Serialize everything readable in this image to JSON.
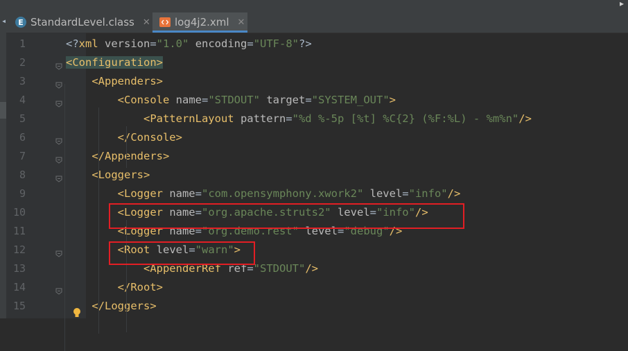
{
  "tabs": [
    {
      "label": "StandardLevel.class",
      "icon": "class-file-icon",
      "active": false
    },
    {
      "label": "log4j2.xml",
      "icon": "xml-file-icon",
      "active": true
    }
  ],
  "line_numbers": [
    "1",
    "2",
    "3",
    "4",
    "5",
    "6",
    "7",
    "8",
    "9",
    "10",
    "11",
    "12",
    "13",
    "14",
    "15"
  ],
  "code_lines": [
    [
      [
        "p",
        "<?"
      ],
      [
        "t",
        "xml "
      ],
      [
        "a",
        "version"
      ],
      [
        "p",
        "="
      ],
      [
        "v",
        "\"1.0\""
      ],
      [
        "p",
        " "
      ],
      [
        "a",
        "encoding"
      ],
      [
        "p",
        "="
      ],
      [
        "v",
        "\"UTF-8\""
      ],
      [
        "p",
        "?>"
      ]
    ],
    [
      [
        "hl",
        "<Configuration>"
      ]
    ],
    [
      [
        "p",
        "    "
      ],
      [
        "t",
        "<Appenders>"
      ]
    ],
    [
      [
        "p",
        "        "
      ],
      [
        "t",
        "<Console "
      ],
      [
        "a",
        "name"
      ],
      [
        "p",
        "="
      ],
      [
        "v",
        "\"STDOUT\""
      ],
      [
        "p",
        " "
      ],
      [
        "a",
        "target"
      ],
      [
        "p",
        "="
      ],
      [
        "v",
        "\"SYSTEM_OUT\""
      ],
      [
        "t",
        ">"
      ]
    ],
    [
      [
        "p",
        "            "
      ],
      [
        "t",
        "<PatternLayout "
      ],
      [
        "a",
        "pattern"
      ],
      [
        "p",
        "="
      ],
      [
        "v",
        "\"%d %-5p [%t] %C{2} (%F:%L) - %m%n\""
      ],
      [
        "t",
        "/>"
      ]
    ],
    [
      [
        "p",
        "        "
      ],
      [
        "t",
        "</Console>"
      ]
    ],
    [
      [
        "p",
        "    "
      ],
      [
        "t",
        "</Appenders>"
      ]
    ],
    [
      [
        "p",
        "    "
      ],
      [
        "t",
        "<Loggers>"
      ]
    ],
    [
      [
        "p",
        "        "
      ],
      [
        "t",
        "<Logger "
      ],
      [
        "a",
        "name"
      ],
      [
        "p",
        "="
      ],
      [
        "v",
        "\"com.opensymphony.xwork2\""
      ],
      [
        "p",
        " "
      ],
      [
        "a",
        "level"
      ],
      [
        "p",
        "="
      ],
      [
        "v",
        "\"info\""
      ],
      [
        "t",
        "/>"
      ]
    ],
    [
      [
        "p",
        "        "
      ],
      [
        "t",
        "<Logger "
      ],
      [
        "a",
        "name"
      ],
      [
        "p",
        "="
      ],
      [
        "v",
        "\"org.apache.struts2\""
      ],
      [
        "p",
        " "
      ],
      [
        "a",
        "level"
      ],
      [
        "p",
        "="
      ],
      [
        "v",
        "\"info\""
      ],
      [
        "t",
        "/>"
      ]
    ],
    [
      [
        "p",
        "        "
      ],
      [
        "t",
        "<Logger "
      ],
      [
        "a",
        "name"
      ],
      [
        "p",
        "="
      ],
      [
        "v",
        "\"org.demo.rest\""
      ],
      [
        "p",
        " "
      ],
      [
        "a",
        "level"
      ],
      [
        "p",
        "="
      ],
      [
        "v",
        "\"debug\""
      ],
      [
        "t",
        "/>"
      ]
    ],
    [
      [
        "p",
        "        "
      ],
      [
        "t",
        "<Root "
      ],
      [
        "a",
        "level"
      ],
      [
        "p",
        "="
      ],
      [
        "v",
        "\"warn\""
      ],
      [
        "t",
        ">"
      ]
    ],
    [
      [
        "p",
        "            "
      ],
      [
        "t",
        "<AppenderRef "
      ],
      [
        "a",
        "ref"
      ],
      [
        "p",
        "="
      ],
      [
        "v",
        "\"STDOUT\""
      ],
      [
        "t",
        "/>"
      ]
    ],
    [
      [
        "p",
        "        "
      ],
      [
        "t",
        "</Root>"
      ]
    ],
    [
      [
        "p",
        "    "
      ],
      [
        "t",
        "</Loggers>"
      ]
    ]
  ],
  "colors": {
    "editor_bg": "#2b2b2b",
    "gutter_bg": "#313335",
    "tag": "#e8bf6a",
    "attr": "#bababa",
    "value": "#6a8759",
    "highlight_box": "#e31e24"
  },
  "icons": {
    "bulb": "lightbulb-icon",
    "chevron": "chevron-left-icon"
  }
}
